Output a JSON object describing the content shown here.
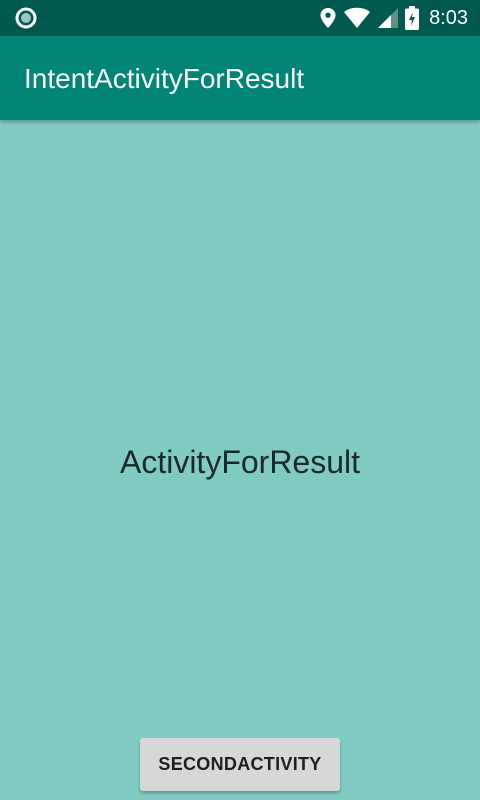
{
  "status_bar": {
    "left_icon": "circle-notification-icon",
    "icons": [
      "location-icon",
      "wifi-icon",
      "cellular-signal-icon",
      "battery-charging-icon"
    ],
    "time": "8:03"
  },
  "app_bar": {
    "title": "IntentActivityForResult"
  },
  "main": {
    "center_text": "ActivityForResult",
    "button_label": "SECONDACTIVITY"
  },
  "colors": {
    "status_bar": "#00594f",
    "app_bar": "#008577",
    "background": "#82cbc4",
    "button": "#d6d7d7"
  }
}
